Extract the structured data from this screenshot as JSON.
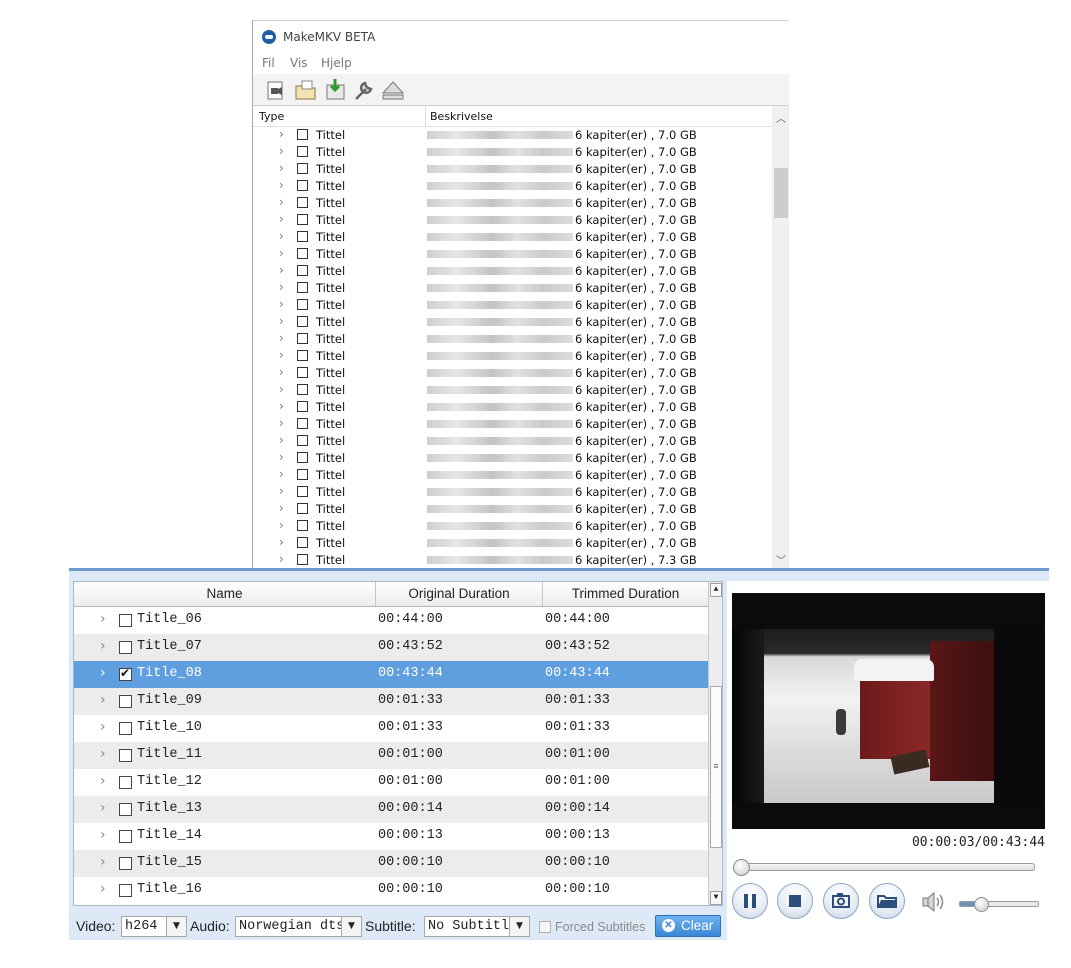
{
  "makemkv": {
    "title": "MakeMKV BETA",
    "menu": [
      "Fil",
      "Vis",
      "Hjelp"
    ],
    "toolbar_icons": [
      "open-file-icon",
      "open-folder-icon",
      "save-to-mkv-icon",
      "settings-wrench-icon",
      "eject-icon"
    ],
    "columns": {
      "type": "Type",
      "description": "Beskrivelse"
    },
    "rows": [
      {
        "type": "Tittel",
        "desc": "6 kapiter(er) , 7.0 GB"
      },
      {
        "type": "Tittel",
        "desc": "6 kapiter(er) , 7.0 GB"
      },
      {
        "type": "Tittel",
        "desc": "6 kapiter(er) , 7.0 GB"
      },
      {
        "type": "Tittel",
        "desc": "6 kapiter(er) , 7.0 GB"
      },
      {
        "type": "Tittel",
        "desc": "6 kapiter(er) , 7.0 GB"
      },
      {
        "type": "Tittel",
        "desc": "6 kapiter(er) , 7.0 GB"
      },
      {
        "type": "Tittel",
        "desc": "6 kapiter(er) , 7.0 GB"
      },
      {
        "type": "Tittel",
        "desc": "6 kapiter(er) , 7.0 GB"
      },
      {
        "type": "Tittel",
        "desc": "6 kapiter(er) , 7.0 GB"
      },
      {
        "type": "Tittel",
        "desc": "6 kapiter(er) , 7.0 GB"
      },
      {
        "type": "Tittel",
        "desc": "6 kapiter(er) , 7.0 GB"
      },
      {
        "type": "Tittel",
        "desc": "6 kapiter(er) , 7.0 GB"
      },
      {
        "type": "Tittel",
        "desc": "6 kapiter(er) , 7.0 GB"
      },
      {
        "type": "Tittel",
        "desc": "6 kapiter(er) , 7.0 GB"
      },
      {
        "type": "Tittel",
        "desc": "6 kapiter(er) , 7.0 GB"
      },
      {
        "type": "Tittel",
        "desc": "6 kapiter(er) , 7.0 GB"
      },
      {
        "type": "Tittel",
        "desc": "6 kapiter(er) , 7.0 GB"
      },
      {
        "type": "Tittel",
        "desc": "6 kapiter(er) , 7.0 GB"
      },
      {
        "type": "Tittel",
        "desc": "6 kapiter(er) , 7.0 GB"
      },
      {
        "type": "Tittel",
        "desc": "6 kapiter(er) , 7.0 GB"
      },
      {
        "type": "Tittel",
        "desc": "6 kapiter(er) , 7.0 GB"
      },
      {
        "type": "Tittel",
        "desc": "6 kapiter(er) , 7.0 GB"
      },
      {
        "type": "Tittel",
        "desc": "6 kapiter(er) , 7.0 GB"
      },
      {
        "type": "Tittel",
        "desc": "6 kapiter(er) , 7.0 GB"
      },
      {
        "type": "Tittel",
        "desc": "6 kapiter(er) , 7.0 GB"
      },
      {
        "type": "Tittel",
        "desc": "6 kapiter(er) , 7.3 GB"
      }
    ]
  },
  "trimmer": {
    "columns": {
      "name": "Name",
      "original": "Original Duration",
      "trimmed": "Trimmed Duration"
    },
    "rows": [
      {
        "name": "Title_06",
        "original": "00:44:00",
        "trimmed": "00:44:00",
        "checked": false,
        "selected": false
      },
      {
        "name": "Title_07",
        "original": "00:43:52",
        "trimmed": "00:43:52",
        "checked": false,
        "selected": false
      },
      {
        "name": "Title_08",
        "original": "00:43:44",
        "trimmed": "00:43:44",
        "checked": true,
        "selected": true
      },
      {
        "name": "Title_09",
        "original": "00:01:33",
        "trimmed": "00:01:33",
        "checked": false,
        "selected": false
      },
      {
        "name": "Title_10",
        "original": "00:01:33",
        "trimmed": "00:01:33",
        "checked": false,
        "selected": false
      },
      {
        "name": "Title_11",
        "original": "00:01:00",
        "trimmed": "00:01:00",
        "checked": false,
        "selected": false
      },
      {
        "name": "Title_12",
        "original": "00:01:00",
        "trimmed": "00:01:00",
        "checked": false,
        "selected": false
      },
      {
        "name": "Title_13",
        "original": "00:00:14",
        "trimmed": "00:00:14",
        "checked": false,
        "selected": false
      },
      {
        "name": "Title_14",
        "original": "00:00:13",
        "trimmed": "00:00:13",
        "checked": false,
        "selected": false
      },
      {
        "name": "Title_15",
        "original": "00:00:10",
        "trimmed": "00:00:10",
        "checked": false,
        "selected": false
      },
      {
        "name": "Title_16",
        "original": "00:00:10",
        "trimmed": "00:00:10",
        "checked": false,
        "selected": false
      }
    ],
    "filters": {
      "video_label": "Video:",
      "video_value": "h264",
      "audio_label": "Audio:",
      "audio_value": "Norwegian dtsl",
      "subtitle_label": "Subtitle:",
      "subtitle_value": "No Subtitle",
      "forced_label": "Forced Subtitles",
      "forced_checked": false,
      "clear_label": "Clear"
    },
    "player": {
      "timecode": "00:00:03/00:43:44",
      "seek_fraction": 0.0011,
      "volume_fraction": 0.25,
      "buttons": [
        "pause-icon",
        "stop-icon",
        "snapshot-camera-icon",
        "open-folder-icon",
        "volume-speaker-icon"
      ]
    }
  },
  "colors": {
    "selection": "#5f9fe0",
    "accent": "#3a86d6",
    "window_frame": "#dde9f6"
  }
}
